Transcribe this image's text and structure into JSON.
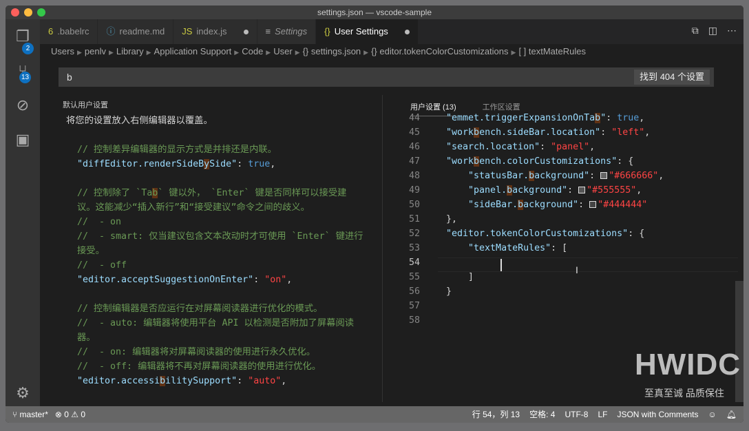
{
  "window": {
    "title": "settings.json — vscode-sample"
  },
  "activity": {
    "explorer_badge": "2",
    "scm_badge": "13"
  },
  "tabs": [
    {
      "icon": "6",
      "label": ".babelrc",
      "icon_color": "#cbcb41"
    },
    {
      "icon": "ⓘ",
      "label": "readme.md",
      "icon_color": "#519aba"
    },
    {
      "icon": "JS",
      "label": "index.js",
      "icon_color": "#cbcb41",
      "dirty": true
    },
    {
      "icon": "≡",
      "label": "Settings",
      "icon_color": "#aaa"
    },
    {
      "icon": "{}",
      "label": "User Settings",
      "icon_color": "#cbcb41",
      "dirty": true,
      "active": true
    }
  ],
  "breadcrumb": [
    "Users",
    "penlv",
    "Library",
    "Application Support",
    "Code",
    "User",
    "{} settings.json",
    "{} editor.tokenColorCustomizations",
    "[ ] textMateRules"
  ],
  "search": {
    "value": "b",
    "result_count": "找到 404 个设置"
  },
  "left_pane": {
    "header": "默认用户设置",
    "lines": [
      [
        [
          "将您的设置放入右侧编辑器以覆盖。",
          "z"
        ]
      ],
      [],
      [
        [
          "  // 控制差异编辑器的显示方式是并排还是内联。",
          "c"
        ]
      ],
      [
        [
          "  \"diffEditor.renderSideB",
          "k"
        ],
        [
          "y",
          "k hl"
        ],
        [
          "Side\"",
          "k"
        ],
        [
          ": ",
          "p"
        ],
        [
          "true",
          "b"
        ],
        [
          ",",
          "p"
        ]
      ],
      [],
      [
        [
          "  // 控制除了 `Ta",
          "c"
        ],
        [
          "b",
          "c hl"
        ],
        [
          "` 键以外， `Enter` 键是否同样可以接受建",
          "c"
        ]
      ],
      [
        [
          "  议。这能减少“插入新行”和“接受建议”命令之间的歧义。",
          "c"
        ]
      ],
      [
        [
          "  //  - on",
          "c"
        ]
      ],
      [
        [
          "  //  - smart: 仅当建议包含文本改动时才可使用 `Enter` 键进行",
          "c"
        ]
      ],
      [
        [
          "  接受。",
          "c"
        ]
      ],
      [
        [
          "  //  - off",
          "c"
        ]
      ],
      [
        [
          "  \"editor.acceptSuggestionOnEnter\"",
          "k"
        ],
        [
          ": ",
          "p"
        ],
        [
          "\"on\"",
          "s"
        ],
        [
          ",",
          "p"
        ]
      ],
      [],
      [
        [
          "  // 控制编辑器是否应运行在对屏幕阅读器进行优化的模式。",
          "c"
        ]
      ],
      [
        [
          "  //  - auto: 编辑器将使用平台 API 以检测是否附加了屏幕阅读",
          "c"
        ]
      ],
      [
        [
          "  器。",
          "c"
        ]
      ],
      [
        [
          "  //  - on: 编辑器将对屏幕阅读器的使用进行永久优化。",
          "c"
        ]
      ],
      [
        [
          "  //  - off: 编辑器将不再对屏幕阅读器的使用进行优化。",
          "c"
        ]
      ],
      [
        [
          "  \"editor.accessi",
          "k"
        ],
        [
          "b",
          "k hl"
        ],
        [
          "ilitySupport\"",
          "k"
        ],
        [
          ": ",
          "p"
        ],
        [
          "\"auto\"",
          "s"
        ],
        [
          ",",
          "p"
        ]
      ]
    ]
  },
  "right_pane": {
    "tabs": [
      "用户设置 (13)",
      "工作区设置"
    ],
    "lines": [
      {
        "n": "44",
        "t": [
          [
            "  \"emmet.triggerExpansionOnTa",
            "k"
          ],
          [
            "b",
            "k hl"
          ],
          [
            "\"",
            "k"
          ],
          [
            ": ",
            "p"
          ],
          [
            "true",
            "b"
          ],
          [
            ",",
            "p"
          ]
        ]
      },
      {
        "n": "45",
        "t": [
          [
            "  \"work",
            "k"
          ],
          [
            "b",
            "k hl"
          ],
          [
            "ench.sideBar.location\"",
            "k"
          ],
          [
            ": ",
            "p"
          ],
          [
            "\"left\"",
            "s"
          ],
          [
            ",",
            "p"
          ]
        ]
      },
      {
        "n": "46",
        "t": [
          [
            "  \"search.location\"",
            "k"
          ],
          [
            ": ",
            "p"
          ],
          [
            "\"panel\"",
            "s"
          ],
          [
            ",",
            "p"
          ]
        ]
      },
      {
        "n": "47",
        "t": [
          [
            "  \"work",
            "k"
          ],
          [
            "b",
            "k hl"
          ],
          [
            "ench.colorCustomizations\"",
            "k"
          ],
          [
            ": {",
            "p"
          ]
        ]
      },
      {
        "n": "48",
        "t": [
          [
            "      \"statusBar.",
            "k"
          ],
          [
            "b",
            "k hl"
          ],
          [
            "ackground\"",
            "k"
          ],
          [
            ": ",
            "p"
          ],
          [
            "#666666",
            "sw"
          ],
          [
            "\"#666666\"",
            "s"
          ],
          [
            ",",
            "p"
          ]
        ]
      },
      {
        "n": "49",
        "t": [
          [
            "      \"panel.",
            "k"
          ],
          [
            "b",
            "k hl"
          ],
          [
            "ackground\"",
            "k"
          ],
          [
            ": ",
            "p"
          ],
          [
            "#555555",
            "sw"
          ],
          [
            "\"#555555\"",
            "s"
          ],
          [
            ",",
            "p"
          ]
        ]
      },
      {
        "n": "50",
        "t": [
          [
            "      \"sideBar.",
            "k"
          ],
          [
            "b",
            "k hl"
          ],
          [
            "ackground\"",
            "k"
          ],
          [
            ": ",
            "p"
          ],
          [
            "#444444",
            "sw"
          ],
          [
            "\"#444444\"",
            "s"
          ]
        ]
      },
      {
        "n": "51",
        "t": [
          [
            "  },",
            "p"
          ]
        ]
      },
      {
        "n": "52",
        "t": [
          [
            "  \"editor.tokenColorCustomizations\"",
            "k"
          ],
          [
            ": {",
            "p"
          ]
        ]
      },
      {
        "n": "53",
        "t": [
          [
            "      \"textMateRules\"",
            "k"
          ],
          [
            ": [",
            "p"
          ]
        ]
      },
      {
        "n": "54",
        "t": [],
        "current": true
      },
      {
        "n": "55",
        "t": [
          [
            "      ]",
            "p"
          ]
        ]
      },
      {
        "n": "56",
        "t": [
          [
            "  }",
            "p"
          ]
        ]
      },
      {
        "n": "57",
        "t": []
      },
      {
        "n": "58",
        "t": []
      }
    ]
  },
  "status": {
    "branch": "master*",
    "errors": "0",
    "warnings": "0",
    "position": "行 54，列 13",
    "indent": "空格: 4",
    "encoding": "UTF-8",
    "eol": "LF",
    "language": "JSON with Comments"
  },
  "watermark": {
    "logo": "HWIDC",
    "slogan": "至真至诚 品质保住"
  }
}
